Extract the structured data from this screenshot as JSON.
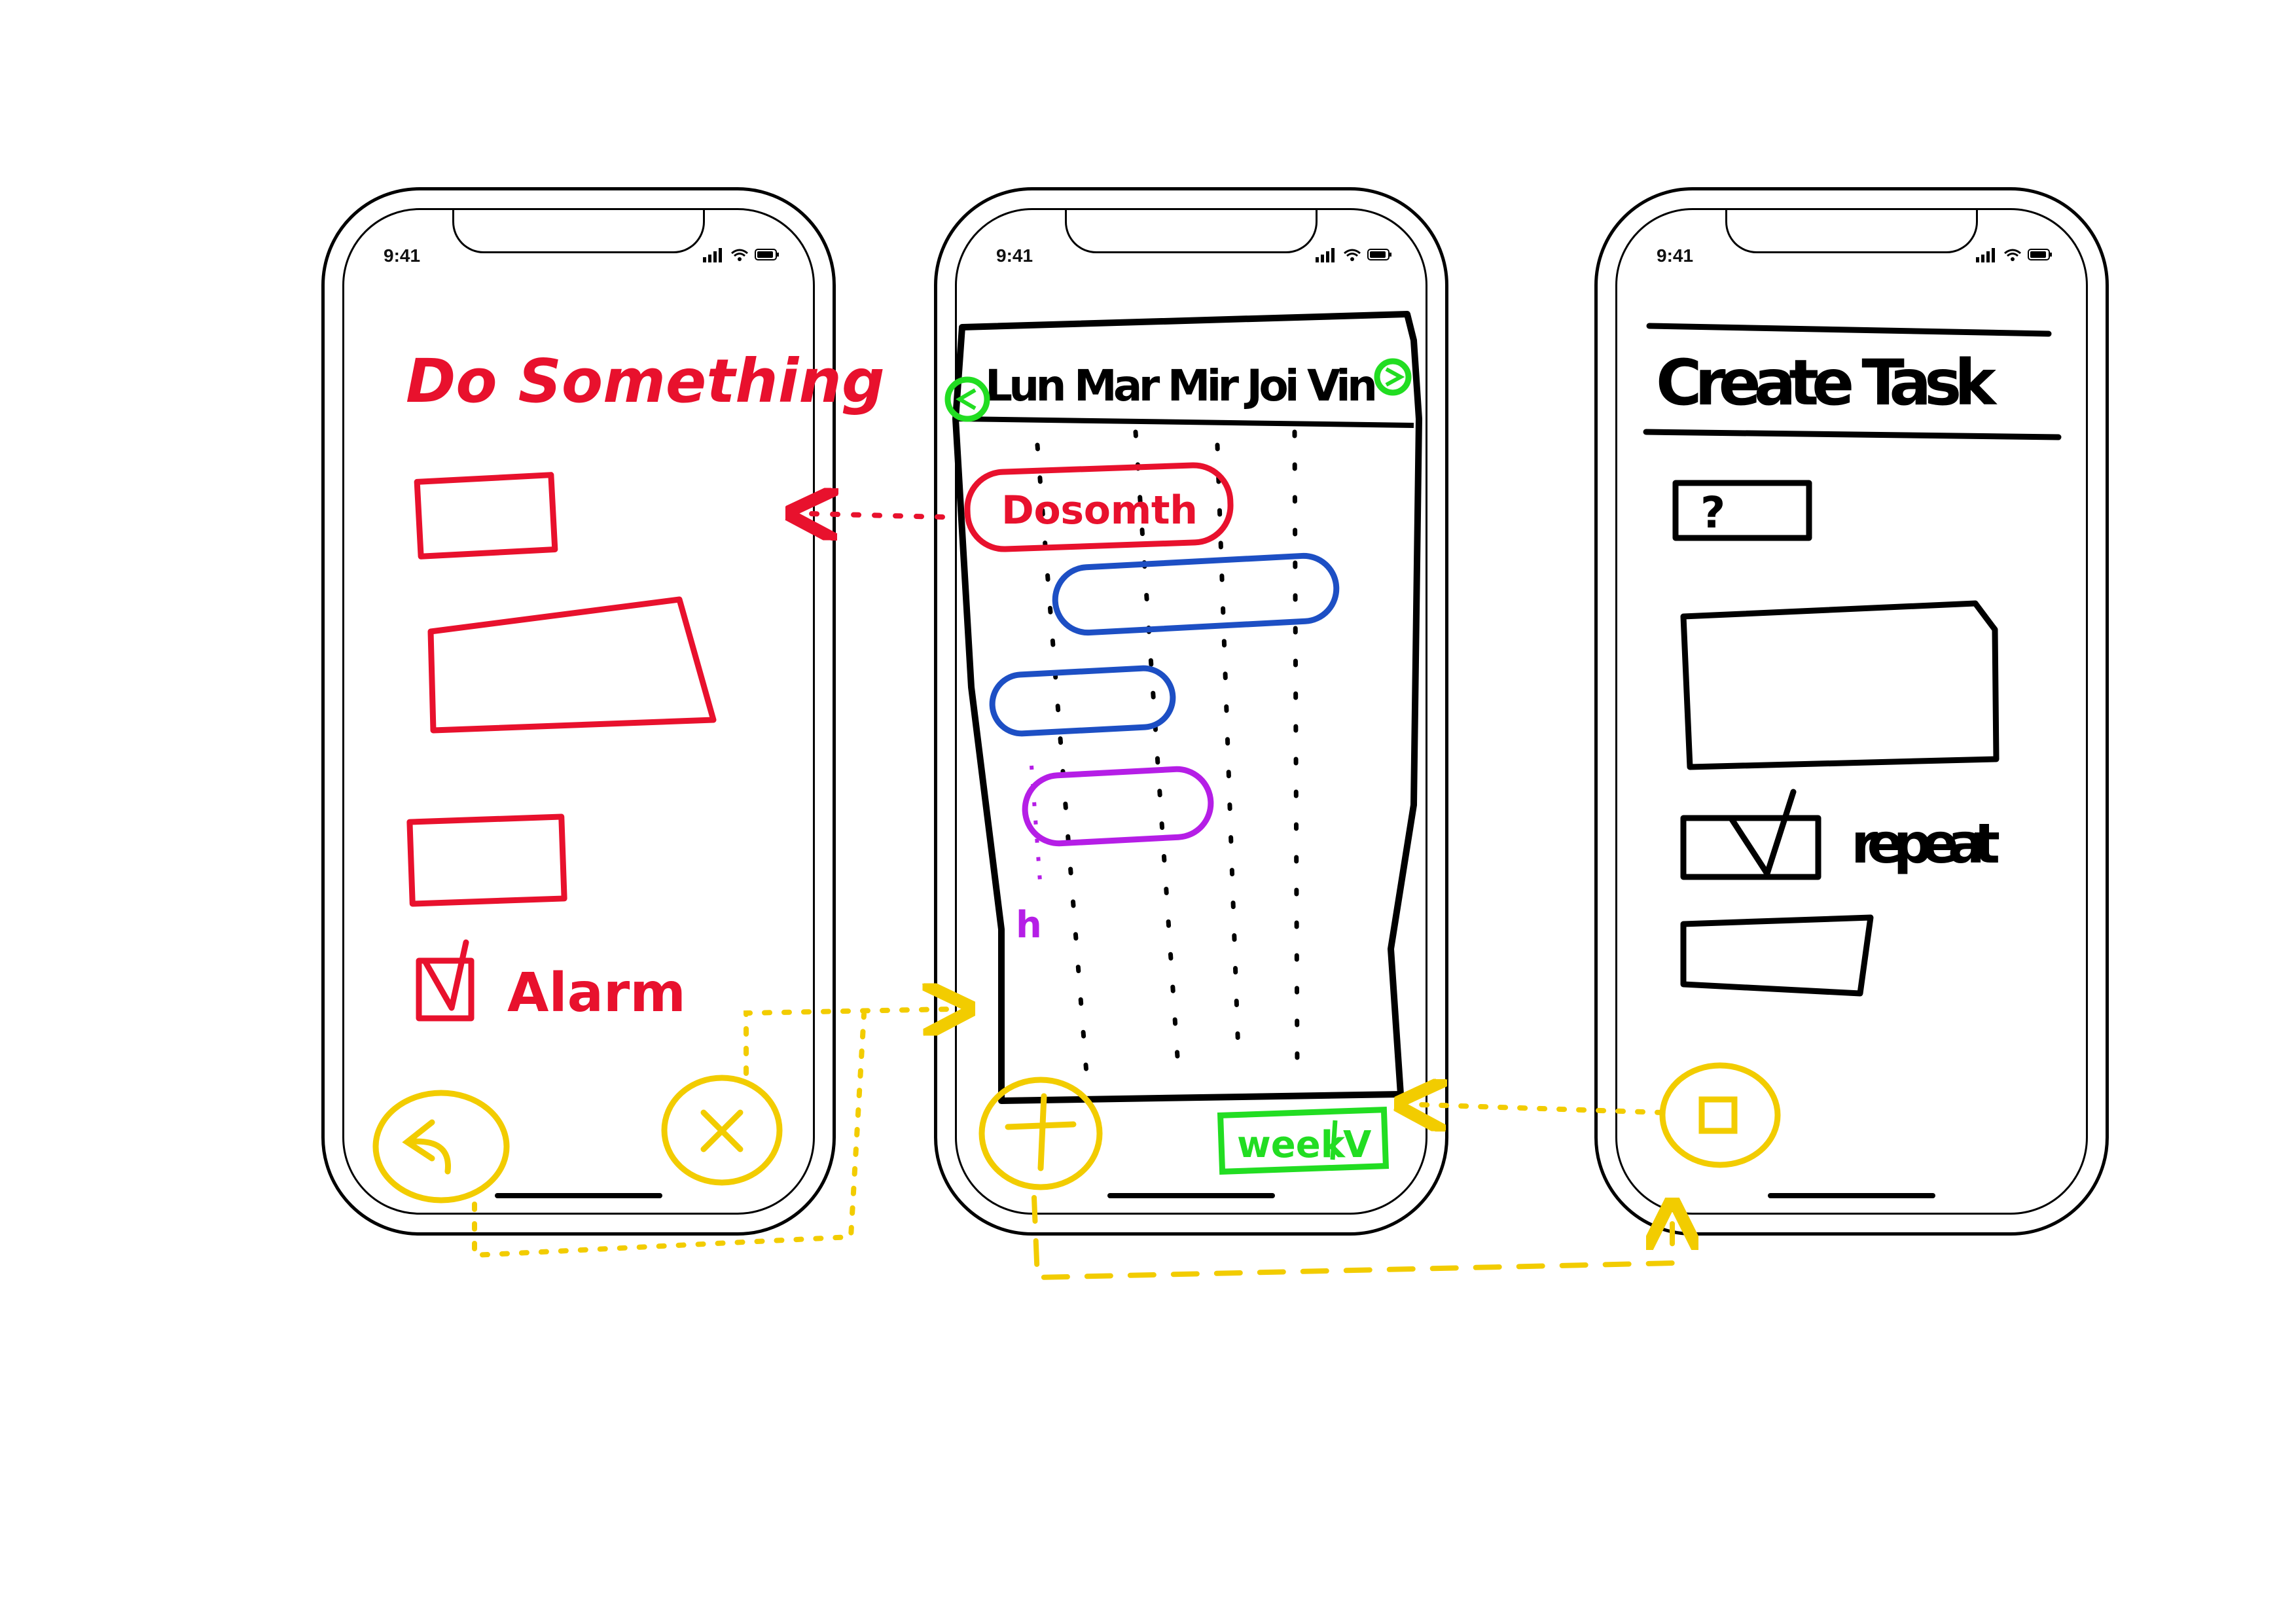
{
  "status_bar": {
    "time": "9:41"
  },
  "colors": {
    "ink": "#000000",
    "red": "#e8112d",
    "blue": "#1d4fc4",
    "purple": "#b51ee6",
    "yellow": "#f2cc00",
    "green": "#22dd22"
  },
  "screen_detail": {
    "title": "Do Something",
    "alarm_label": "Alarm",
    "alarm_checked": true,
    "back_icon": "back-arrow-icon",
    "cancel_icon": "close-icon"
  },
  "screen_calendar": {
    "day_headers": "Lun Mar Mir Joi Vin",
    "task_label": "Dosomth",
    "view_select": {
      "label": "week",
      "chevron": "V"
    },
    "add_icon": "plus-icon",
    "prev_icon": "prev-arrow-icon",
    "next_icon": "next-arrow-icon",
    "note_mark": "h"
  },
  "screen_create": {
    "title": "Create Task",
    "field_1_placeholder": "?",
    "repeat_label": "repeat",
    "repeat_checked": true,
    "calendar_icon": "calendar-icon"
  }
}
